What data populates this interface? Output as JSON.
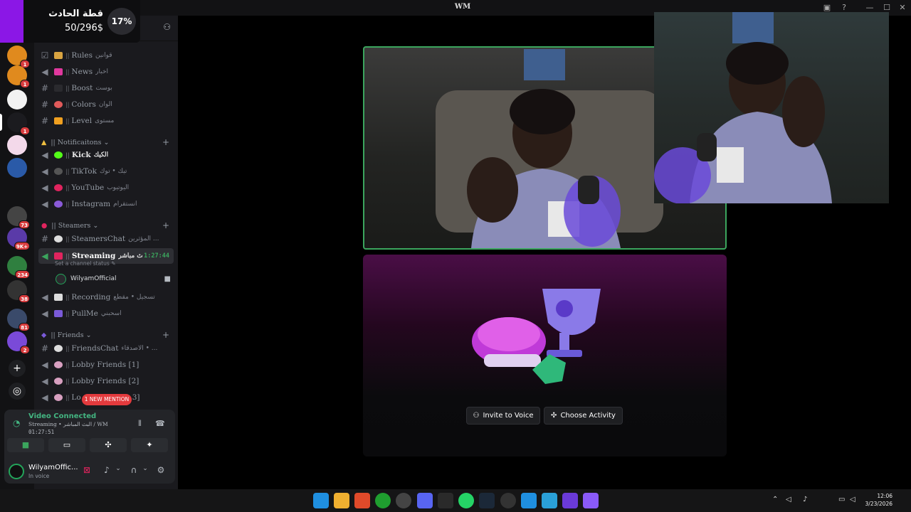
{
  "window": {
    "title": "WM"
  },
  "overlay": {
    "label": "قطة الحادث",
    "progress": "50/296$",
    "percent": "17%"
  },
  "rail": {
    "badges": [
      "1",
      "1",
      "1",
      "73",
      "9K+",
      "234",
      "38",
      "81",
      "2"
    ]
  },
  "channels": [
    {
      "type": "text",
      "name": "Rules",
      "arabic": "قوانين"
    },
    {
      "type": "voice",
      "name": "News",
      "arabic": "اخبار"
    },
    {
      "type": "text",
      "name": "Boost",
      "arabic": "بوست"
    },
    {
      "type": "text",
      "name": "Colors",
      "arabic": "الوان"
    },
    {
      "type": "text",
      "name": "Level",
      "arabic": "مستوى"
    }
  ],
  "categories": {
    "notifications": "Notificaitons",
    "streamers": "Steamers",
    "friends": "Friends"
  },
  "notif_channels": [
    {
      "name": "Kick",
      "arabic": "الكيك"
    },
    {
      "name": "TikTok",
      "arabic": "تيك • توك"
    },
    {
      "name": "YouTube",
      "arabic": "اليوتيوب"
    },
    {
      "name": "Instagram",
      "arabic": "انستقرام"
    }
  ],
  "streamer_channels": {
    "chat": {
      "name": "SteamersChat",
      "arabic": "المؤثرين ..."
    },
    "streaming": {
      "name": "Streaming",
      "arabic": "بث مباشر",
      "timer": "1:27:44",
      "status": "Set a channel status"
    },
    "voice_user": "WilyamOfficial",
    "recording": {
      "name": "Recording",
      "arabic": "تسجيل • مقطع"
    },
    "pullme": {
      "name": "PullMe",
      "arabic": "اسحبني"
    }
  },
  "friend_channels": {
    "chat": {
      "name": "FriendsChat",
      "arabic": "الأصدقاء • ..."
    },
    "lobby1": "Lobby Friends [1]",
    "lobby2": "Lobby Friends [2]",
    "lobby3_start": "Lo",
    "lobby3_end": "3]"
  },
  "mention": "1 NEW MENTION",
  "voice": {
    "connected": "Video Connected",
    "channel": "Streaming • البث المباشر / WM",
    "elapsed": "01:27:51"
  },
  "user": {
    "name": "WilyamOffic...",
    "status": "In voice"
  },
  "stage": {
    "invite": "Invite to Voice",
    "activity": "Choose Activity"
  },
  "clock": {
    "time": "12:06",
    "date": "3/23/2026"
  },
  "colors": {
    "accent": "#8b17e6",
    "green": "#3ba55d",
    "red": "#d83c3e"
  }
}
